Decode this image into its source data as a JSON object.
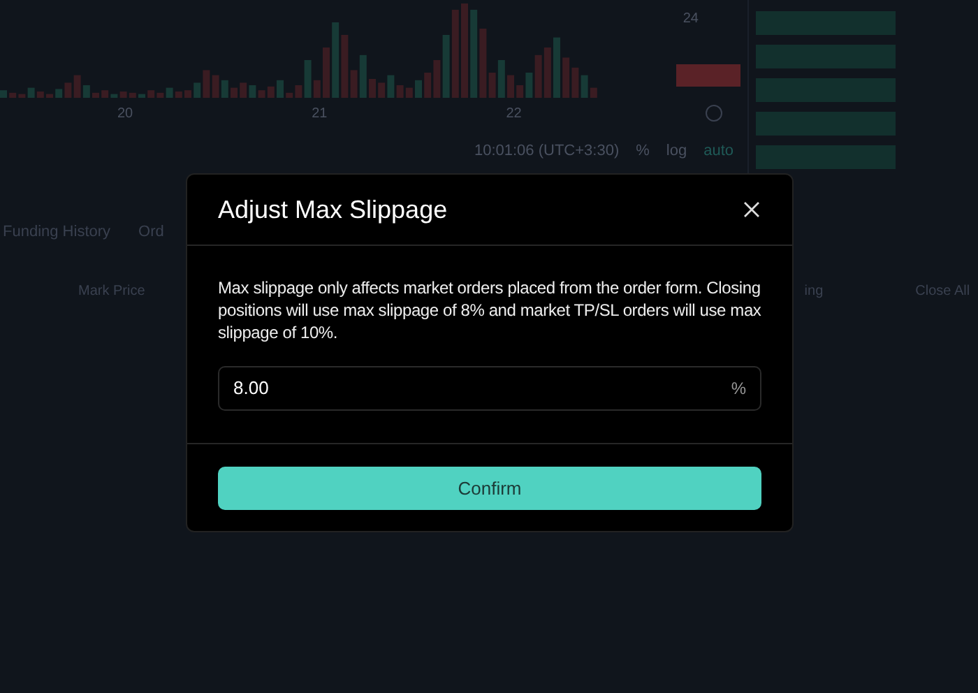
{
  "background": {
    "chart": {
      "axis_labels": [
        "20",
        "21",
        "22"
      ],
      "scale_label": "24",
      "time": "10:01:06 (UTC+3:30)",
      "scale_options": [
        "%",
        "log",
        "auto"
      ]
    },
    "tabs": [
      {
        "label": "Funding History",
        "selected": false
      },
      {
        "label": "Ord",
        "selected": false
      }
    ],
    "columns": [
      "Mark Price",
      "ing",
      "Close All"
    ]
  },
  "dialog": {
    "title": "Adjust Max Slippage",
    "message": "Max slippage only affects market orders placed from the order form. Closing positions will use max slippage of 8% and market TP/SL orders will use max slippage of 10%.",
    "field": {
      "value": "8.00",
      "unit": "%"
    },
    "button": "Confirm"
  }
}
